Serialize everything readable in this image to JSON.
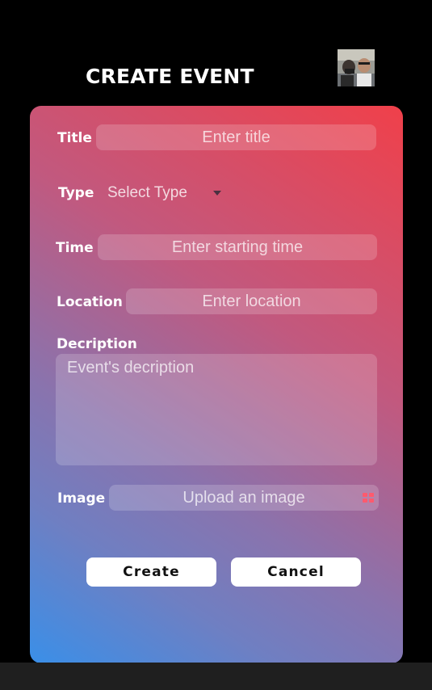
{
  "header": {
    "title": "CREATE EVENT"
  },
  "form": {
    "title": {
      "label": "Title",
      "placeholder": "Enter title"
    },
    "type": {
      "label": "Type",
      "selected": "Select Type"
    },
    "time": {
      "label": "Time",
      "placeholder": "Enter starting time"
    },
    "location": {
      "label": "Location",
      "placeholder": "Enter location"
    },
    "description": {
      "label": "Decription",
      "placeholder": "Event's decription"
    },
    "image": {
      "label": "Image",
      "placeholder": "Upload an image",
      "icon": "grid-upload-icon"
    }
  },
  "actions": {
    "create_label": "Create",
    "cancel_label": "Cancel"
  },
  "colors": {
    "background": "#000000",
    "gradient_top_right": "#f0404a",
    "gradient_bottom_left": "#3a8fe8",
    "button_bg": "#ffffff",
    "upload_icon": "#ff5a6e"
  }
}
